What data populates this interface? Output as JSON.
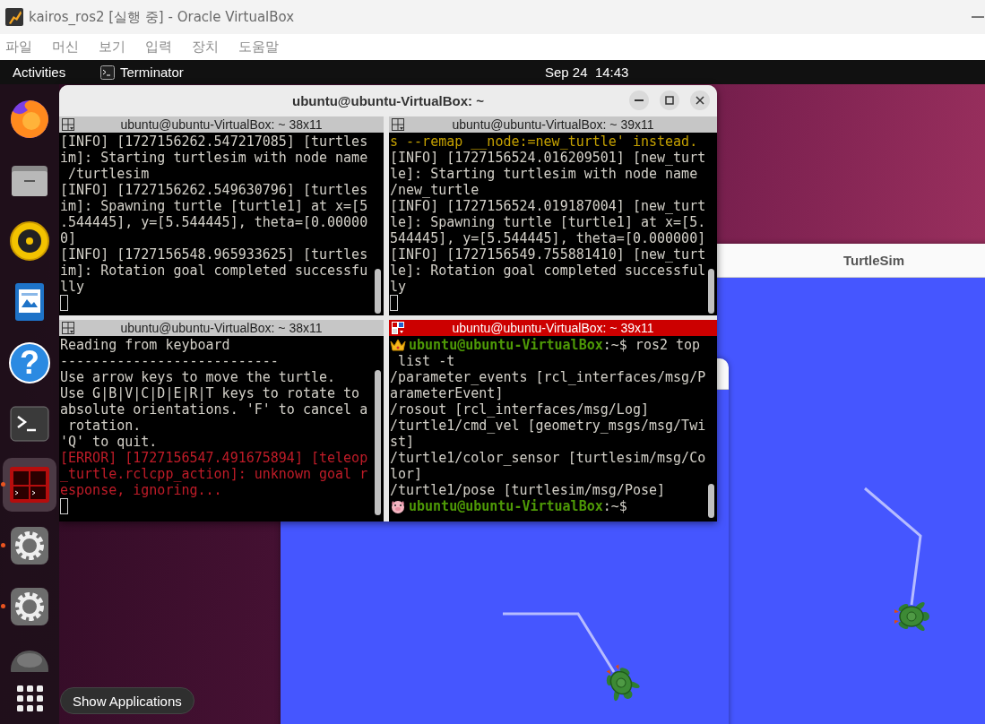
{
  "vbox": {
    "title": "kairos_ros2 [실행 중] - Oracle VirtualBox",
    "menu": [
      "파일",
      "머신",
      "보기",
      "입력",
      "장치",
      "도움말"
    ]
  },
  "topbar": {
    "activities": "Activities",
    "app": "Terminator",
    "clock": "Sep 24  14:43"
  },
  "dock": {
    "items": [
      {
        "kind": "browser",
        "running": false,
        "selected": false
      },
      {
        "kind": "files",
        "running": false,
        "selected": false
      },
      {
        "kind": "speaker",
        "running": false,
        "selected": false
      },
      {
        "kind": "document",
        "running": false,
        "selected": false
      },
      {
        "kind": "help",
        "glyph": "?",
        "running": false,
        "selected": false
      },
      {
        "kind": "terminal",
        "running": false,
        "selected": false
      },
      {
        "kind": "terminator",
        "running": true,
        "selected": true
      },
      {
        "kind": "settings",
        "running": true,
        "selected": false
      },
      {
        "kind": "settings",
        "running": true,
        "selected": false
      },
      {
        "kind": "partial",
        "running": false,
        "selected": false
      }
    ],
    "tooltip": "Show Applications"
  },
  "terminator": {
    "title": "ubuntu@ubuntu-VirtualBox: ~",
    "panes": [
      {
        "title": "ubuntu@ubuntu-VirtualBox: ~ 38x11",
        "focused": false,
        "lines": [
          {
            "kind": "text",
            "text": "[INFO] [1727156262.547217085] [turtles"
          },
          {
            "kind": "text",
            "text": "im]: Starting turtlesim with node name"
          },
          {
            "kind": "text",
            "text": " /turtlesim"
          },
          {
            "kind": "text",
            "text": "[INFO] [1727156262.549630796] [turtles"
          },
          {
            "kind": "text",
            "text": "im]: Spawning turtle [turtle1] at x=[5"
          },
          {
            "kind": "text",
            "text": ".544445], y=[5.544445], theta=[0.00000"
          },
          {
            "kind": "text",
            "text": "0]"
          },
          {
            "kind": "text",
            "text": "[INFO] [1727156548.965933625] [turtles"
          },
          {
            "kind": "text",
            "text": "im]: Rotation goal completed successfu"
          },
          {
            "kind": "text",
            "text": "lly"
          },
          {
            "kind": "cursor"
          }
        ]
      },
      {
        "title": "ubuntu@ubuntu-VirtualBox: ~ 39x11",
        "focused": false,
        "lines": [
          {
            "kind": "warn",
            "text": "s --remap __node:=new_turtle' instead."
          },
          {
            "kind": "text",
            "text": "[INFO] [1727156524.016209501] [new_turt"
          },
          {
            "kind": "text",
            "text": "le]: Starting turtlesim with node name"
          },
          {
            "kind": "text",
            "text": "/new_turtle"
          },
          {
            "kind": "text",
            "text": "[INFO] [1727156524.019187004] [new_turt"
          },
          {
            "kind": "text",
            "text": "le]: Spawning turtle [turtle1] at x=[5."
          },
          {
            "kind": "text",
            "text": "544445], y=[5.544445], theta=[0.000000]"
          },
          {
            "kind": "text",
            "text": "[INFO] [1727156549.755881410] [new_turt"
          },
          {
            "kind": "text",
            "text": "le]: Rotation goal completed successful"
          },
          {
            "kind": "text",
            "text": "ly"
          },
          {
            "kind": "cursor"
          }
        ]
      },
      {
        "title": "ubuntu@ubuntu-VirtualBox: ~ 38x11",
        "focused": false,
        "lines": [
          {
            "kind": "text",
            "text": "Reading from keyboard"
          },
          {
            "kind": "text",
            "text": "---------------------------"
          },
          {
            "kind": "text",
            "text": "Use arrow keys to move the turtle."
          },
          {
            "kind": "text",
            "text": "Use G|B|V|C|D|E|R|T keys to rotate to"
          },
          {
            "kind": "text",
            "text": "absolute orientations. 'F' to cancel a"
          },
          {
            "kind": "text",
            "text": " rotation."
          },
          {
            "kind": "text",
            "text": "'Q' to quit."
          },
          {
            "kind": "error",
            "text": "[ERROR] [1727156547.491675894] [teleop"
          },
          {
            "kind": "error",
            "text": "_turtle.rclcpp_action]: unknown goal r"
          },
          {
            "kind": "error",
            "text": "esponse, ignoring..."
          },
          {
            "kind": "cursor"
          }
        ]
      },
      {
        "title": "ubuntu@ubuntu-VirtualBox: ~ 39x11",
        "focused": true,
        "lines": [
          {
            "kind": "crown_prompt",
            "user": "ubuntu@ubuntu-VirtualBox",
            "text": ":~$ ros2 top"
          },
          {
            "kind": "text",
            "text": " list -t"
          },
          {
            "kind": "text",
            "text": "/parameter_events [rcl_interfaces/msg/P"
          },
          {
            "kind": "text",
            "text": "arameterEvent]"
          },
          {
            "kind": "text",
            "text": "/rosout [rcl_interfaces/msg/Log]"
          },
          {
            "kind": "text",
            "text": "/turtle1/cmd_vel [geometry_msgs/msg/Twi"
          },
          {
            "kind": "text",
            "text": "st]"
          },
          {
            "kind": "text",
            "text": "/turtle1/color_sensor [turtlesim/msg/Co"
          },
          {
            "kind": "text",
            "text": "lor]"
          },
          {
            "kind": "text",
            "text": "/turtle1/pose [turtlesim/msg/Pose]"
          },
          {
            "kind": "pig_prompt",
            "user": "ubuntu@ubuntu-VirtualBox",
            "text": ":~$"
          }
        ]
      }
    ]
  },
  "turtlesim": {
    "title": "TurtleSim"
  }
}
